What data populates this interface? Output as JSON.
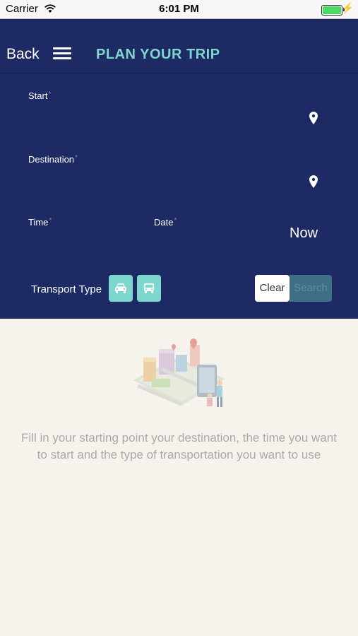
{
  "status_bar": {
    "carrier": "Carrier",
    "time": "6:01 PM"
  },
  "nav": {
    "back_label": "Back",
    "title": "PLAN YOUR TRIP"
  },
  "form": {
    "start_label": "Start",
    "destination_label": "Destination",
    "time_label": "Time",
    "date_label": "Date",
    "required_mark": "*",
    "start_value": "",
    "destination_value": "",
    "time_value": "",
    "date_value": "",
    "now_text": "Now"
  },
  "transport": {
    "label": "Transport Type",
    "options": [
      "car-icon",
      "bus-icon"
    ]
  },
  "actions": {
    "clear_label": "Clear",
    "search_label": "Search"
  },
  "hint": "Fill in your starting point your destination, the time you want to start and the type of transportation you want to use",
  "colors": {
    "header_bg": "#1e2a63",
    "accent": "#7ed7cf",
    "page_bg": "#f5f3ec",
    "search_button": "#3d6f85"
  }
}
